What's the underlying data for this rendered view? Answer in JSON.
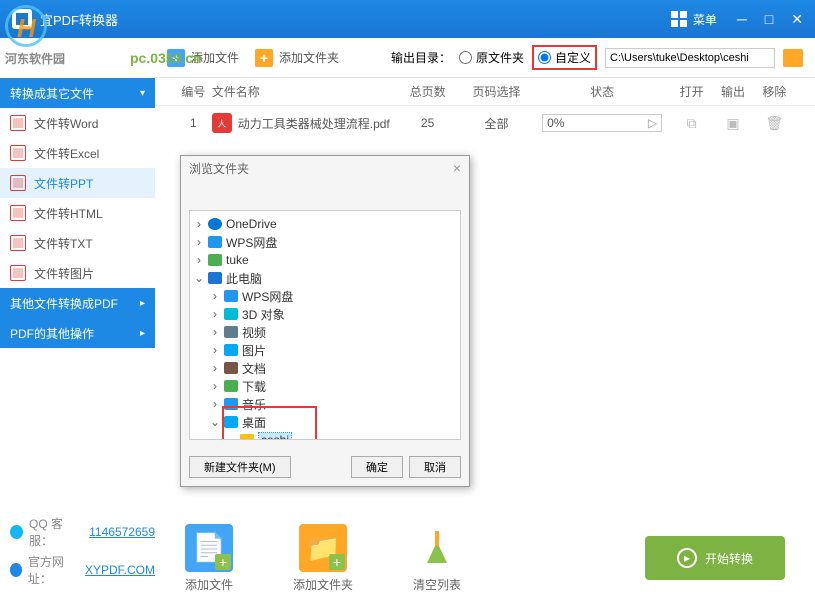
{
  "titlebar": {
    "title": "宜PDF转换器",
    "menu": "菜单"
  },
  "watermark": {
    "site": "河东软件园",
    "url": "pc.0359.cn",
    "prefix": "PDF"
  },
  "toolbar": {
    "add_file": "添加文件",
    "add_folder": "添加文件夹",
    "output_label": "输出目录：",
    "radio_source": "原文件夹",
    "radio_custom": "自定义",
    "path": "C:\\Users\\tuke\\Desktop\\ceshi"
  },
  "sidebar": {
    "cat1": "转换成其它文件",
    "items": [
      "文件转Word",
      "文件转Excel",
      "文件转PPT",
      "文件转HTML",
      "文件转TXT",
      "文件转图片"
    ],
    "cat2": "其他文件转换成PDF",
    "cat3": "PDF的其他操作"
  },
  "footer": {
    "qq_label": "QQ 客服：",
    "qq": "1146572659",
    "site_label": "官方网址：",
    "site": "XYPDF.COM"
  },
  "table": {
    "headers": {
      "num": "编号",
      "name": "文件名称",
      "pages": "总页数",
      "sel": "页码选择",
      "status": "状态",
      "open": "打开",
      "out": "输出",
      "del": "移除"
    },
    "rows": [
      {
        "num": "1",
        "name": "动力工具类器械处理流程.pdf",
        "pages": "25",
        "sel": "全部",
        "progress": "0%"
      }
    ]
  },
  "bottom": {
    "add_file": "添加文件",
    "add_folder": "添加文件夹",
    "clear": "清空列表",
    "start": "开始转换"
  },
  "dialog": {
    "title": "浏览文件夹",
    "tree": {
      "onedrive": "OneDrive",
      "wps": "WPS网盘",
      "user": "tuke",
      "pc": "此电脑",
      "wps2": "WPS网盘",
      "obj3d": "3D 对象",
      "video": "视频",
      "pic": "图片",
      "doc": "文档",
      "dl": "下载",
      "music": "音乐",
      "desk": "桌面",
      "ceshi": "ceshi"
    },
    "new_folder": "新建文件夹(M)",
    "ok": "确定",
    "cancel": "取消"
  }
}
